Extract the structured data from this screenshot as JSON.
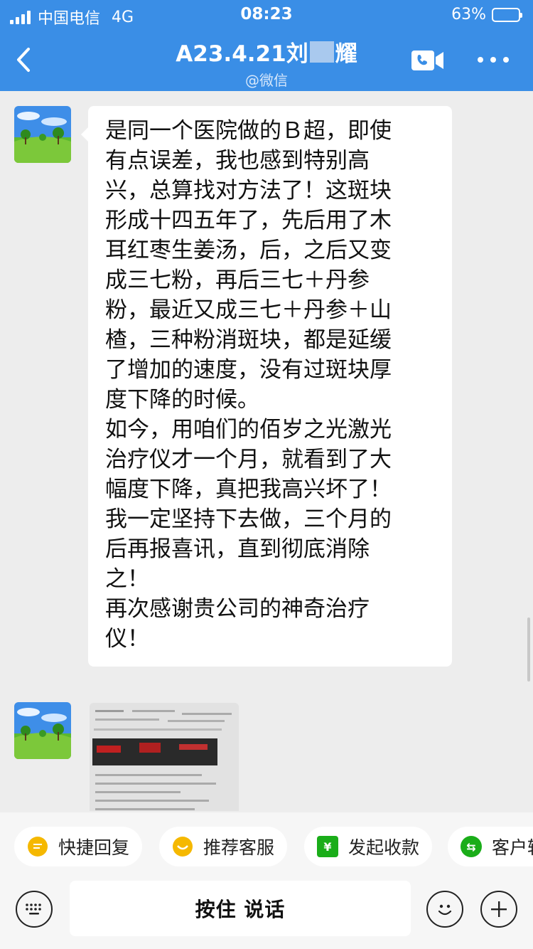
{
  "status_bar": {
    "carrier": "中国电信",
    "network": "4G",
    "time": "08:23",
    "battery_percent": "63%",
    "battery_level": 0.63
  },
  "header": {
    "title_prefix": "A23.4.21刘",
    "title_suffix": "耀",
    "subtitle": "@微信",
    "back_icon": "chevron-left-icon",
    "video_icon": "video-call-icon",
    "more_icon": "more-dots-icon",
    "background_color": "#3a8ee6"
  },
  "messages": [
    {
      "type": "text",
      "lines": [
        "是同一个医院做的Ｂ超，即使",
        "有点误差，我也感到特别高",
        "兴，总算找对方法了！这斑块",
        "形成十四五年了，先后用了木",
        "耳红枣生姜汤，后，之后又变",
        "成三七粉，再后三七＋丹参",
        "粉，最近又成三七＋丹参＋山",
        "楂，三种粉消斑块，都是延缓",
        "了增加的速度，没有过斑块厚",
        "度下降的时候。",
        "如今，用咱们的佰岁之光激光",
        "治疗仪才一个月，就看到了大",
        "幅度下降，真把我高兴坏了！",
        "我一定坚持下去做，三个月的",
        "后再报喜讯，直到彻底消除",
        "之！",
        "再次感谢贵公司的神奇治疗",
        "仪！"
      ]
    },
    {
      "type": "image"
    }
  ],
  "quick_replies": [
    {
      "label": "快捷回复",
      "icon": "quick-reply-icon",
      "color": "#f5b800"
    },
    {
      "label": "推荐客服",
      "icon": "recommend-agent-icon",
      "color": "#f5b800"
    },
    {
      "label": "发起收款",
      "icon": "yuan-payment-icon",
      "color": "#1aad19",
      "glyph": "¥"
    },
    {
      "label": "客户转",
      "icon": "transfer-icon",
      "color": "#1aad19",
      "glyph": "⇆"
    }
  ],
  "input_bar": {
    "hold_to_talk": "按住 说话",
    "keyboard_icon": "keyboard-icon",
    "emoji_icon": "emoji-icon",
    "plus_icon": "plus-icon"
  }
}
